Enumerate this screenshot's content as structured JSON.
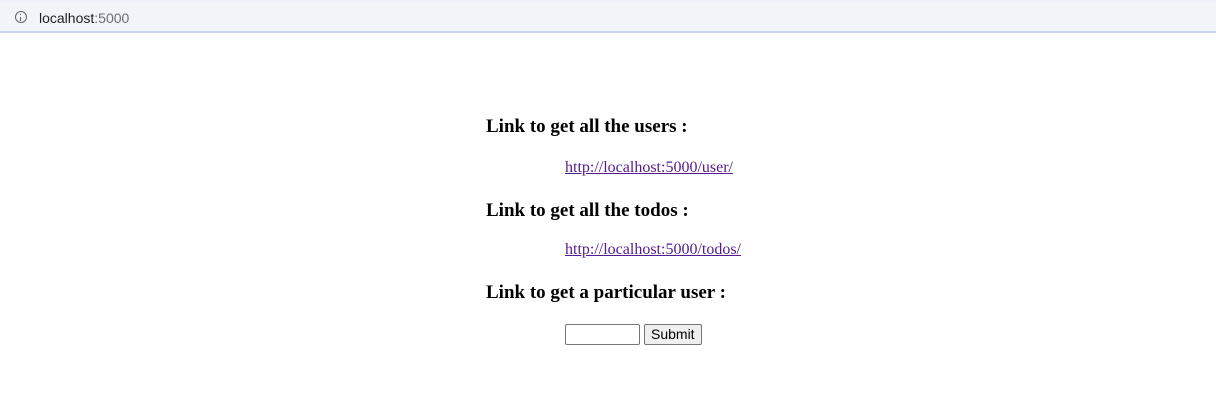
{
  "browser": {
    "url_host": "localhost",
    "url_port": ":5000",
    "info_icon": "info-icon"
  },
  "page": {
    "sections": [
      {
        "heading": "Link to get all the users :",
        "link_text": "http://localhost:5000/user/"
      },
      {
        "heading": "Link to get all the todos :",
        "link_text": "http://localhost:5000/todos/"
      },
      {
        "heading": "Link to get a particular user :"
      }
    ],
    "form": {
      "input_value": "",
      "submit_label": "Submit"
    }
  },
  "colors": {
    "link_visited": "#551a8b",
    "addressbar_bg": "#f1f4f9"
  }
}
